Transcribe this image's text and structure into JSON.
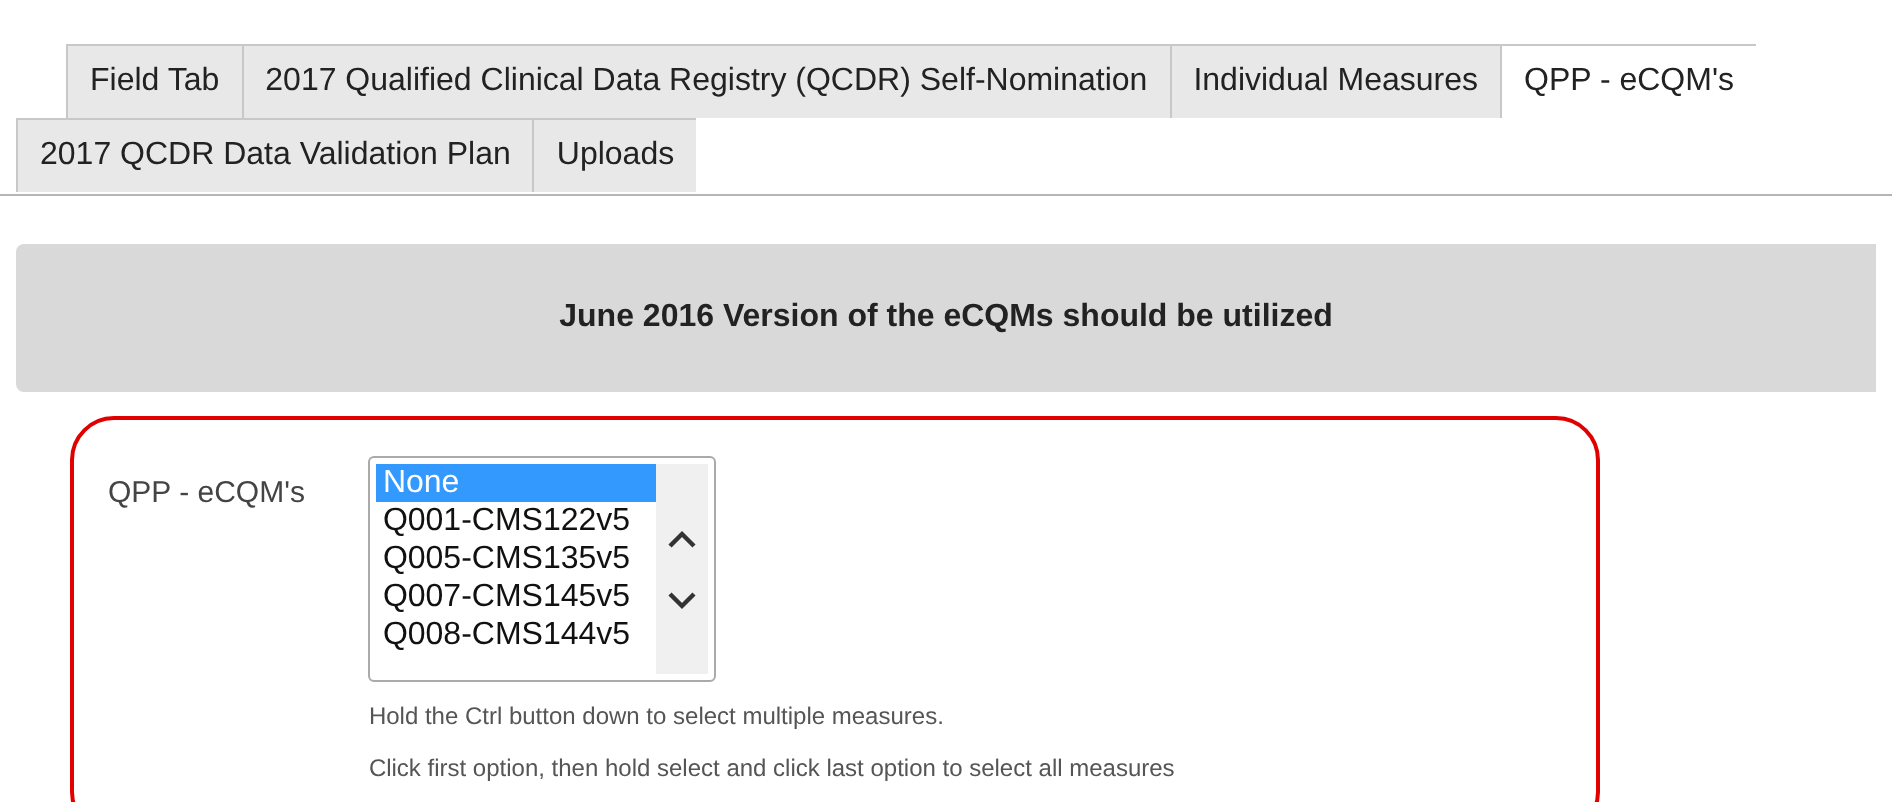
{
  "tabs": [
    {
      "label": "Field Tab",
      "selected": false
    },
    {
      "label": "2017 Qualified Clinical Data Registry (QCDR) Self-Nomination",
      "selected": false
    },
    {
      "label": "Individual Measures",
      "selected": false
    },
    {
      "label": "QPP - eCQM's",
      "selected": true
    },
    {
      "label": "2017 QCDR Data Validation Plan",
      "selected": false
    },
    {
      "label": "Uploads",
      "selected": false
    }
  ],
  "banner": "June 2016 Version of the eCQMs should be utilized",
  "field": {
    "label": "QPP - eCQM's",
    "options": [
      {
        "label": "None",
        "selected": true
      },
      {
        "label": "Q001-CMS122v5",
        "selected": false
      },
      {
        "label": "Q005-CMS135v5",
        "selected": false
      },
      {
        "label": "Q007-CMS145v5",
        "selected": false
      },
      {
        "label": "Q008-CMS144v5",
        "selected": false
      }
    ]
  },
  "hints": [
    "Hold the Ctrl button down to select multiple measures.",
    "Click first option, then hold select and click last option to select all measures"
  ]
}
